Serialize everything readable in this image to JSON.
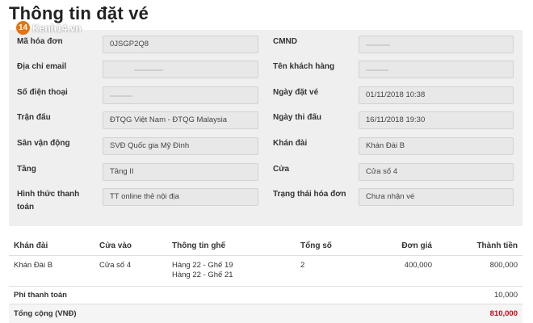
{
  "page": {
    "title": "Thông tin đặt vé"
  },
  "watermark": {
    "badge": "14",
    "text": "Kenh14.vn"
  },
  "colors": {
    "panel_bg": "#efefef",
    "field_bg": "#e8e8e8",
    "total_red": "#d0021b",
    "watermark_orange": "#e8730c"
  },
  "info": {
    "rows": [
      {
        "left_label": "Mã hóa đơn",
        "left_value": "0JSGP2Q8",
        "right_label": "CMND",
        "right_value": ""
      },
      {
        "left_label": "Địa chỉ email",
        "left_value": "",
        "right_label": "Tên khách hàng",
        "right_value": ""
      },
      {
        "left_label": "Số điện thoại",
        "left_value": "",
        "right_label": "Ngày đặt vé",
        "right_value": "01/11/2018 10:38"
      },
      {
        "left_label": "Trận đấu",
        "left_value": "ĐTQG Việt Nam - ĐTQG Malaysia",
        "right_label": "Ngày thi đấu",
        "right_value": "16/11/2018 19:30"
      },
      {
        "left_label": "Sân vận động",
        "left_value": "SVĐ Quốc gia Mỹ Đình",
        "right_label": "Khán đài",
        "right_value": "Khán Đài B"
      },
      {
        "left_label": "Tầng",
        "left_value": "Tầng II",
        "right_label": "Cửa",
        "right_value": "Cửa số 4"
      },
      {
        "left_label": "Hình thức thanh toán",
        "left_value": "TT online thẻ nội địa",
        "right_label": "Trạng thái hóa đơn",
        "right_value": "Chưa nhận vé"
      }
    ]
  },
  "table": {
    "headers": {
      "stand": "Khán đài",
      "gate": "Cửa vào",
      "seat_info": "Thông tin ghế",
      "quantity": "Tổng số",
      "unit_price": "Đơn giá",
      "subtotal": "Thành tiền"
    },
    "row": {
      "stand": "Khán Đài B",
      "gate": "Cửa số 4",
      "seat_1": "Hàng 22 - Ghế 19",
      "seat_2": "Hàng 22 - Ghế 21",
      "quantity": "2",
      "unit_price": "400,000",
      "subtotal": "800,000"
    },
    "fee": {
      "label": "Phí thanh toán",
      "value": "10,000"
    },
    "total": {
      "label": "Tổng cộng (VNĐ)",
      "value": "810,000"
    }
  }
}
